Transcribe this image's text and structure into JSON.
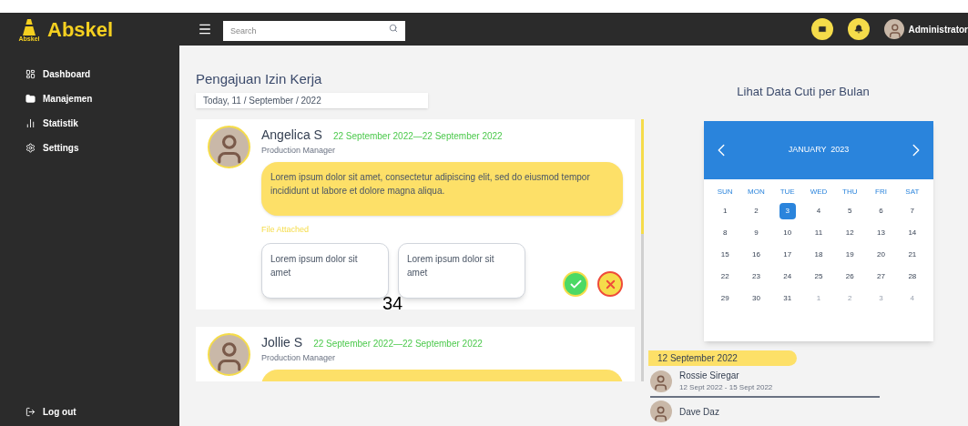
{
  "brand": {
    "logo_caption": "Abskel",
    "name": "Abskel"
  },
  "search": {
    "placeholder": "Search"
  },
  "user": {
    "name": "Administrator"
  },
  "sidebar": {
    "items": [
      {
        "label": "Dashboard"
      },
      {
        "label": "Manajemen"
      },
      {
        "label": "Statistik"
      },
      {
        "label": "Settings"
      }
    ],
    "logout": "Log out"
  },
  "page": {
    "title": "Pengajuan Izin Kerja",
    "date": "Today, 11 / September / 2022",
    "page_number": "34"
  },
  "requests": [
    {
      "name": "Angelica S",
      "dates": "22 September 2022—22 September 2022",
      "role": "Production Manager",
      "message": "Lorem ipsum dolor sit amet, consectetur adipiscing elit, sed do eiusmod tempor incididunt ut labore et dolore magna aliqua.",
      "files_label": "File Attached",
      "files": [
        "Lorem ipsum dolor sit amet",
        "Lorem ipsum dolor sit amet"
      ]
    },
    {
      "name": "Jollie S",
      "dates": "22 September 2022—22 September 2022",
      "role": "Production Manager"
    }
  ],
  "calendar": {
    "title": "Lihat Data Cuti per Bulan",
    "month": "JANUARY  2023",
    "weekdays": [
      "SUN",
      "MON",
      "TUE",
      "WED",
      "THU",
      "FRI",
      "SAT"
    ],
    "days": [
      {
        "label": "1",
        "muted": false,
        "selected": false
      },
      {
        "label": "2",
        "muted": false,
        "selected": false
      },
      {
        "label": "3",
        "muted": false,
        "selected": true
      },
      {
        "label": "4",
        "muted": false,
        "selected": false
      },
      {
        "label": "5",
        "muted": false,
        "selected": false
      },
      {
        "label": "6",
        "muted": false,
        "selected": false
      },
      {
        "label": "7",
        "muted": false,
        "selected": false
      },
      {
        "label": "8",
        "muted": false,
        "selected": false
      },
      {
        "label": "9",
        "muted": false,
        "selected": false
      },
      {
        "label": "10",
        "muted": false,
        "selected": false
      },
      {
        "label": "11",
        "muted": false,
        "selected": false
      },
      {
        "label": "12",
        "muted": false,
        "selected": false
      },
      {
        "label": "13",
        "muted": false,
        "selected": false
      },
      {
        "label": "14",
        "muted": false,
        "selected": false
      },
      {
        "label": "15",
        "muted": false,
        "selected": false
      },
      {
        "label": "16",
        "muted": false,
        "selected": false
      },
      {
        "label": "17",
        "muted": false,
        "selected": false
      },
      {
        "label": "18",
        "muted": false,
        "selected": false
      },
      {
        "label": "19",
        "muted": false,
        "selected": false
      },
      {
        "label": "20",
        "muted": false,
        "selected": false
      },
      {
        "label": "21",
        "muted": false,
        "selected": false
      },
      {
        "label": "22",
        "muted": false,
        "selected": false
      },
      {
        "label": "23",
        "muted": false,
        "selected": false
      },
      {
        "label": "24",
        "muted": false,
        "selected": false
      },
      {
        "label": "25",
        "muted": false,
        "selected": false
      },
      {
        "label": "26",
        "muted": false,
        "selected": false
      },
      {
        "label": "27",
        "muted": false,
        "selected": false
      },
      {
        "label": "28",
        "muted": false,
        "selected": false
      },
      {
        "label": "29",
        "muted": false,
        "selected": false
      },
      {
        "label": "30",
        "muted": false,
        "selected": false
      },
      {
        "label": "31",
        "muted": false,
        "selected": false
      },
      {
        "label": "1",
        "muted": true,
        "selected": false
      },
      {
        "label": "2",
        "muted": true,
        "selected": false
      },
      {
        "label": "3",
        "muted": true,
        "selected": false
      },
      {
        "label": "4",
        "muted": true,
        "selected": false
      }
    ]
  },
  "leave": {
    "date": "12 September 2022",
    "people": [
      {
        "name": "Rossie Siregar",
        "dates": "12 Sept 2022 - 15 Sept 2022"
      },
      {
        "name": "Dave Daz"
      }
    ]
  }
}
